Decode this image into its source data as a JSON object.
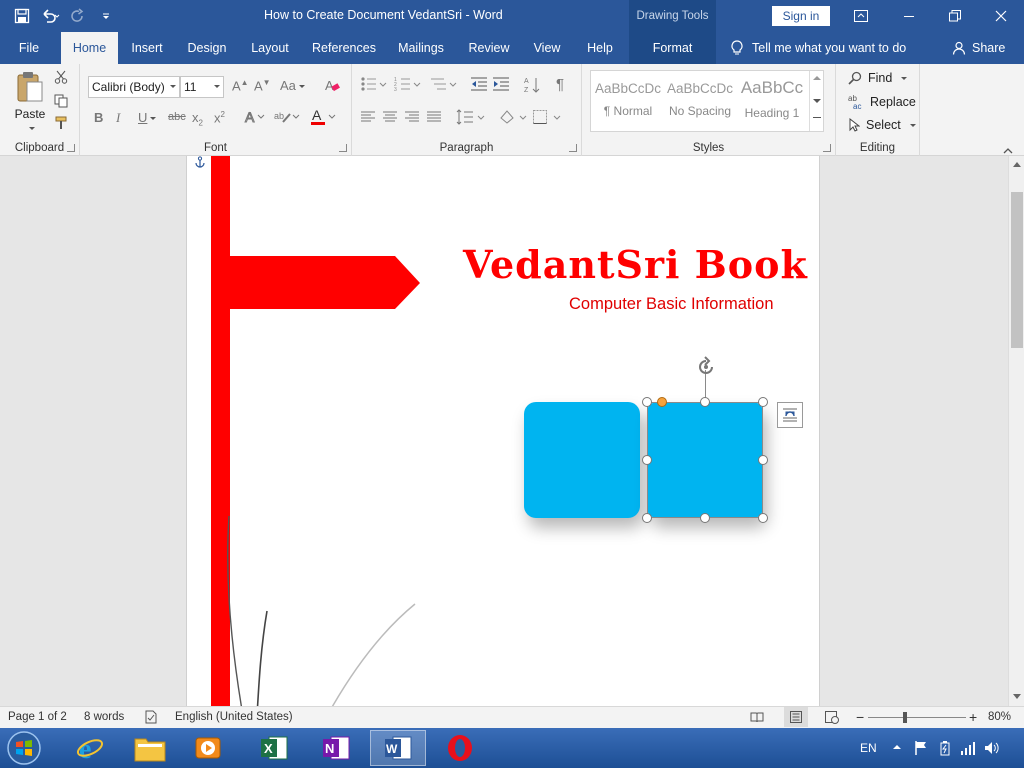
{
  "titlebar": {
    "doc_title": "How to Create Document VedantSri  -  Word",
    "drawing_tools": "Drawing Tools",
    "signin": "Sign in"
  },
  "tabs": [
    {
      "label": "File"
    },
    {
      "label": "Home"
    },
    {
      "label": "Insert"
    },
    {
      "label": "Design"
    },
    {
      "label": "Layout"
    },
    {
      "label": "References"
    },
    {
      "label": "Mailings"
    },
    {
      "label": "Review"
    },
    {
      "label": "View"
    },
    {
      "label": "Help"
    },
    {
      "label": "Format"
    }
  ],
  "tellme": "Tell me what you want to do",
  "share": "Share",
  "ribbon": {
    "clipboard": {
      "paste": "Paste",
      "label": "Clipboard"
    },
    "font": {
      "name": "Calibri (Body)",
      "size": "11",
      "label": "Font"
    },
    "paragraph": {
      "label": "Paragraph"
    },
    "styles": {
      "label": "Styles",
      "items": [
        {
          "sample": "AaBbCcDc",
          "name": "¶ Normal"
        },
        {
          "sample": "AaBbCcDc",
          "name": "No Spacing"
        },
        {
          "sample": "AaBbCc",
          "name": "Heading 1"
        }
      ]
    },
    "editing": {
      "find": "Find",
      "replace": "Replace",
      "select": "Select",
      "label": "Editing"
    }
  },
  "document": {
    "title": "VedantSri Book",
    "subtitle": "Computer Basic Information"
  },
  "statusbar": {
    "page": "Page 1 of 2",
    "words": "8 words",
    "language": "English (United States)",
    "zoom": "80%"
  },
  "tray": {
    "lang": "EN"
  },
  "colors": {
    "word_blue": "#2b579a",
    "accent_red": "#ff0000",
    "shape_cyan": "#00b4f0"
  }
}
